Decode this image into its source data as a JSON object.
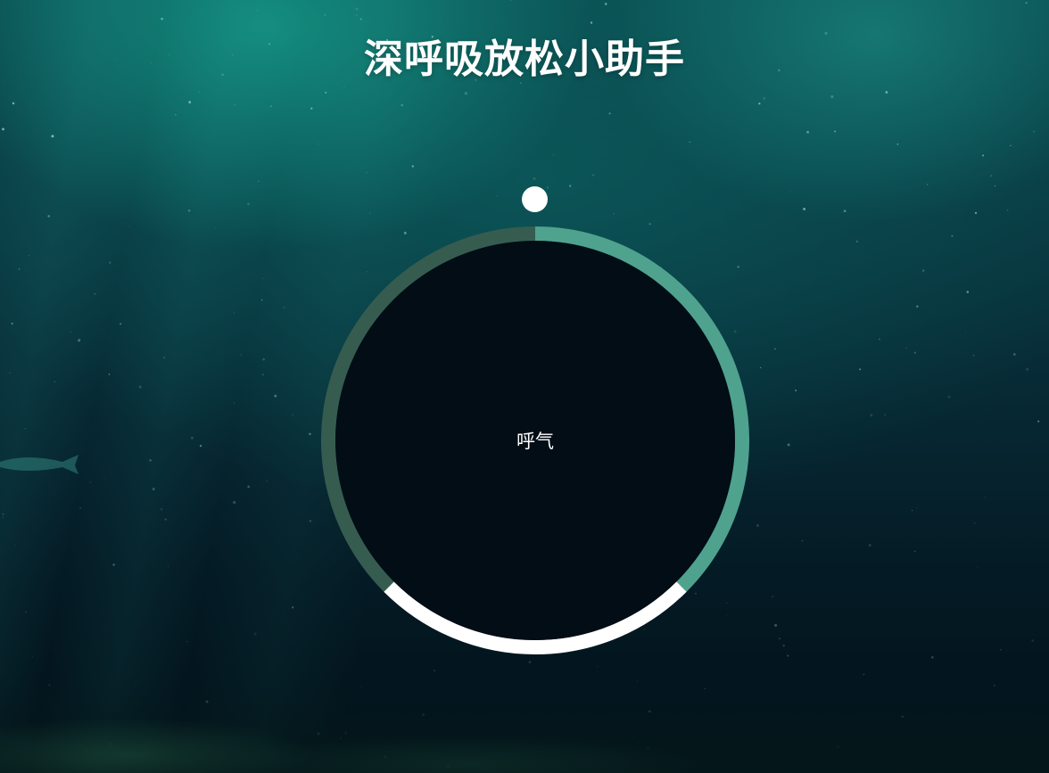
{
  "app": {
    "title": "深呼吸放松小助手"
  },
  "breathing": {
    "current_phase": "呼气",
    "segments": [
      {
        "phase": "inhale",
        "fraction": 0.375,
        "color": "#4fa28e"
      },
      {
        "phase": "hold",
        "fraction": 0.25,
        "color": "#ffffff"
      },
      {
        "phase": "exhale",
        "fraction": 0.375,
        "color": "#365c50"
      }
    ],
    "progress_fraction": 0.0
  },
  "colors": {
    "circle_fill": "#020d16",
    "pointer": "#ffffff",
    "title": "#ffffff"
  }
}
